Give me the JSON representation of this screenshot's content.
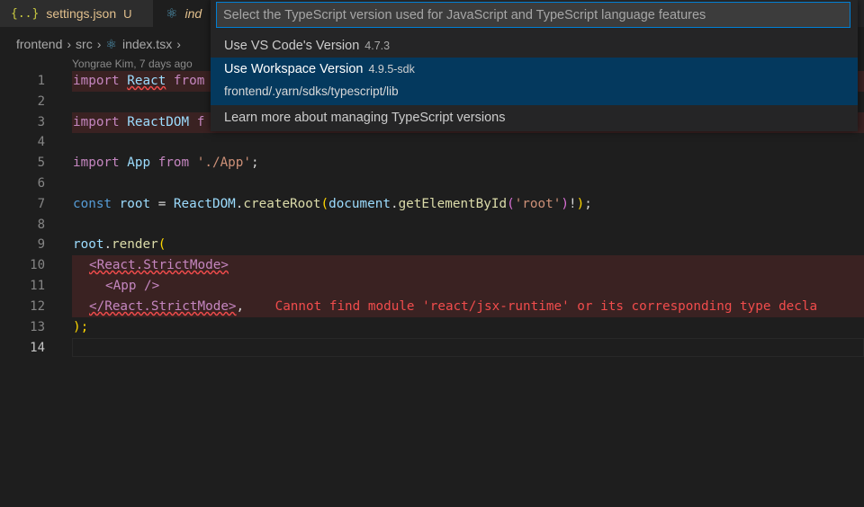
{
  "tabs": [
    {
      "icon": "{..}",
      "label": "settings.json",
      "status": "U"
    },
    {
      "label": "ind"
    }
  ],
  "breadcrumb": [
    "frontend",
    "src",
    "index.tsx"
  ],
  "blame": "Yongrae Kim, 7 days ago",
  "line_numbers": [
    "1",
    "2",
    "3",
    "4",
    "5",
    "6",
    "7",
    "8",
    "9",
    "10",
    "11",
    "12",
    "13",
    "14"
  ],
  "code": {
    "l1": {
      "kw": "import",
      "name": "React",
      "from": "from"
    },
    "l3": {
      "kw": "import",
      "name": "ReactDOM",
      "rest": "f"
    },
    "l5": {
      "kw": "import",
      "name": "App",
      "from": "from",
      "str": "'./App'",
      "semi": ";"
    },
    "l7": {
      "const": "const",
      "root": "root",
      "eq": " = ",
      "obj": "ReactDOM",
      "dot1": ".",
      "fn": "createRoot",
      "p1": "(",
      "doc": "document",
      "dot2": ".",
      "fn2": "getElementById",
      "p2": "(",
      "str": "'root'",
      "p3": ")",
      "bang": "!",
      "p4": ")",
      "semi": ";"
    },
    "l9": {
      "root": "root",
      "dot": ".",
      "fn": "render",
      "paren": "("
    },
    "l10": "<React.StrictMode>",
    "l11": "<App />",
    "l12": {
      "tag": "</React.StrictMode>",
      "comma": ",",
      "error": "Cannot find module 'react/jsx-runtime' or its corresponding type decla"
    },
    "l13": ");"
  },
  "quick_pick": {
    "placeholder": "Select the TypeScript version used for JavaScript and TypeScript language features",
    "items": [
      {
        "label": "Use VS Code's Version",
        "description": "4.7.3"
      },
      {
        "label": "Use Workspace Version",
        "description": "4.9.5-sdk",
        "detail": "frontend/.yarn/sdks/typescript/lib"
      },
      {
        "label": "Learn more about managing TypeScript versions"
      }
    ]
  },
  "colors": {
    "accent": "#007fd4",
    "selection": "#04395e",
    "error": "#f14c4c"
  }
}
